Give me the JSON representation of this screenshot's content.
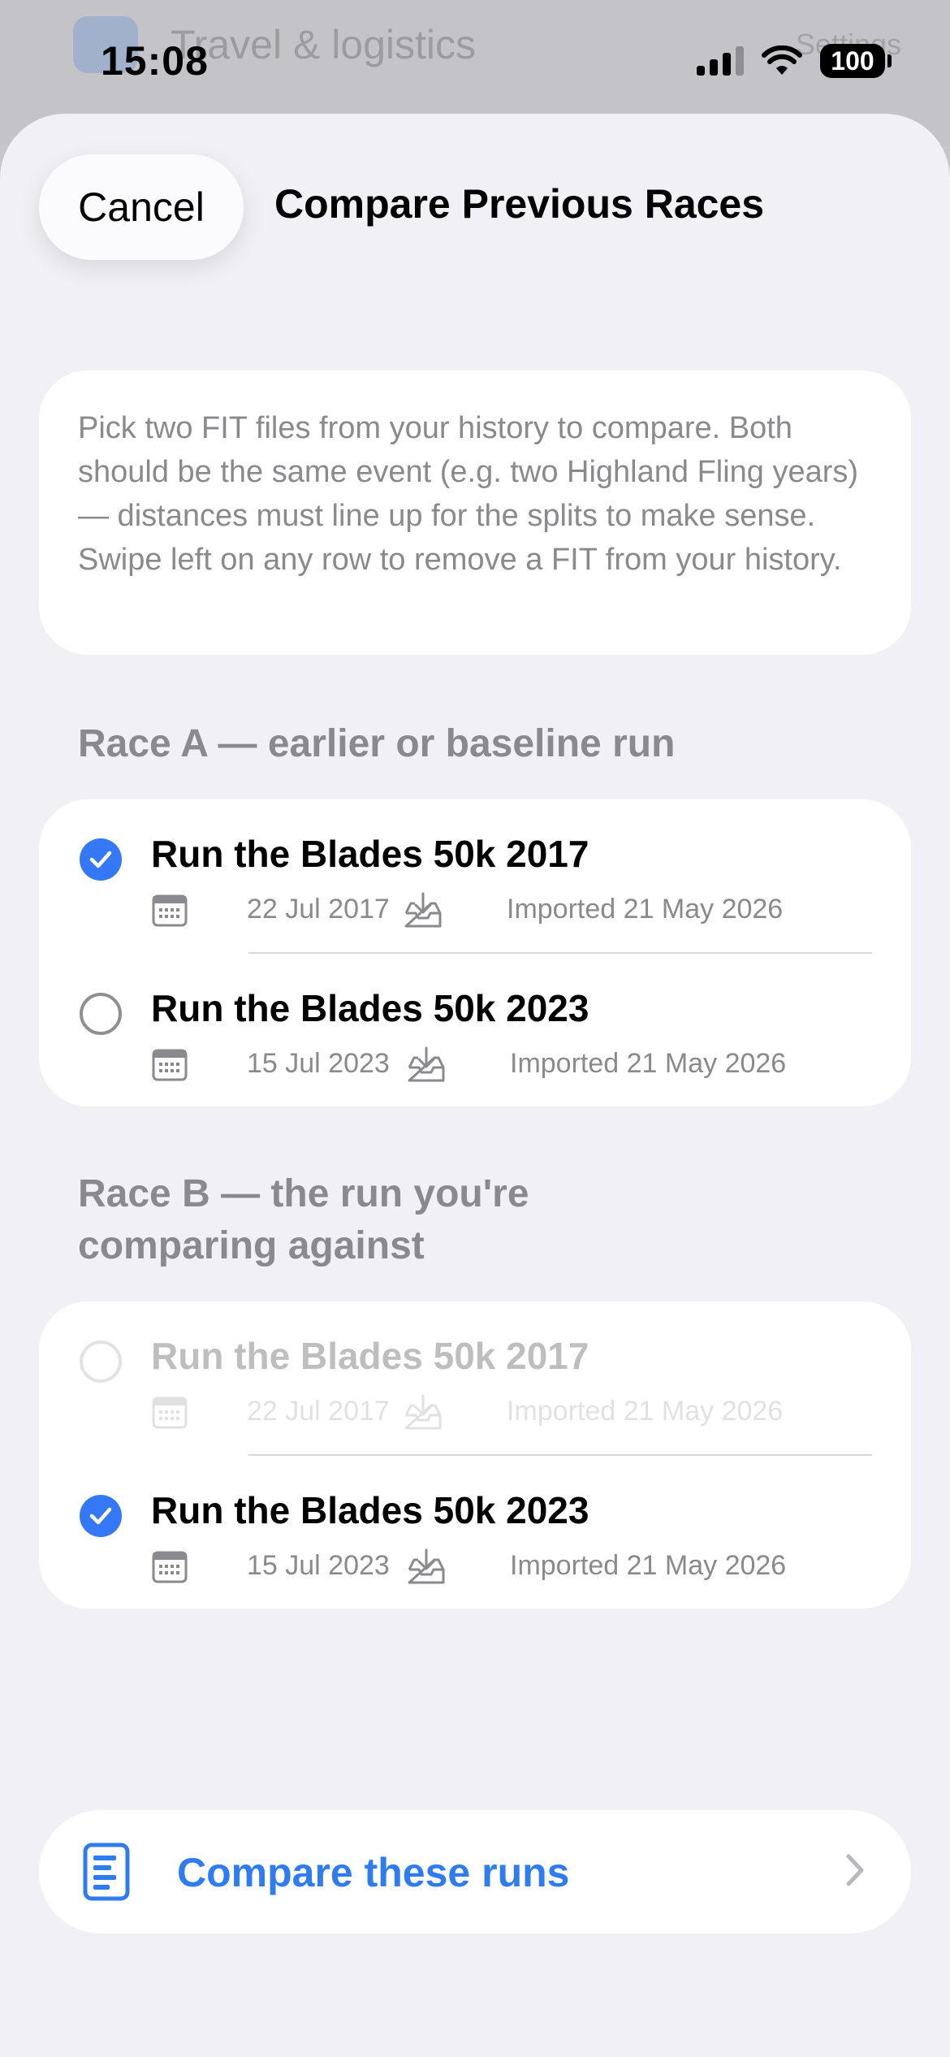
{
  "background": {
    "title": "Travel & logistics",
    "right_text": "Settings"
  },
  "status_bar": {
    "time": "15:08",
    "battery": "100"
  },
  "sheet": {
    "cancel_label": "Cancel",
    "title": "Compare Previous Races",
    "info_text": "Pick two FIT files from your history to compare. Both should be the same event (e.g. two Highland Fling years) — distances must line up for the splits to make sense. Swipe left on any row to remove a FIT from your history."
  },
  "race_a": {
    "header": "Race A — earlier or baseline run",
    "rows": [
      {
        "title": "Run the Blades 50k 2017",
        "date": "22 Jul 2017",
        "imported": "Imported 21 May 2026",
        "selected": true
      },
      {
        "title": "Run the Blades 50k 2023",
        "date": "15 Jul 2023",
        "imported": "Imported 21 May 2026",
        "selected": false
      }
    ]
  },
  "race_b": {
    "header_line1": "Race B — the run you're",
    "header_line2": "comparing against",
    "rows": [
      {
        "title": "Run the Blades 50k 2017",
        "date": "22 Jul 2017",
        "imported": "Imported 21 May 2026",
        "selected": false,
        "disabled": true
      },
      {
        "title": "Run the Blades 50k 2023",
        "date": "15 Jul 2023",
        "imported": "Imported 21 May 2026",
        "selected": true
      }
    ]
  },
  "compare": {
    "label": "Compare these runs"
  },
  "colors": {
    "accent": "#3478f6",
    "link": "#2f7cf0",
    "secondary_text": "#8a8a8e",
    "sheet_bg": "#f0f0f5"
  },
  "icons": [
    "calendar-icon",
    "tray-download-icon",
    "checkmark-icon",
    "document-icon",
    "chevron-right-icon",
    "wifi-icon",
    "signal-icon"
  ]
}
